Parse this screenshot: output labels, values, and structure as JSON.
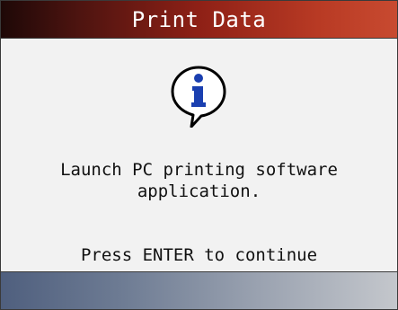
{
  "header": {
    "title": "Print Data"
  },
  "dialog": {
    "icon": "info-icon",
    "message": "Launch PC printing software\napplication.",
    "prompt": "Press ENTER to continue"
  },
  "colors": {
    "title_bar_start": "#1e0807",
    "title_bar_end": "#c84a30",
    "info_icon_blue": "#1a3fb0",
    "bottom_bar_start": "#4f5f7e",
    "bottom_bar_end": "#c4c7cc"
  }
}
